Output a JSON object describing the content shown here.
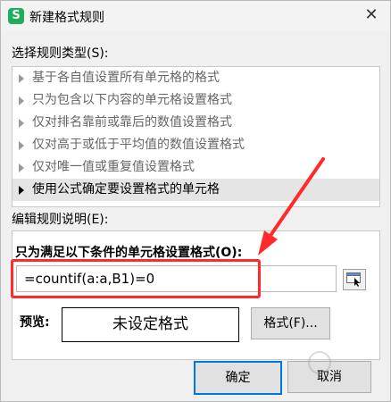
{
  "window": {
    "app_icon_letter": "S",
    "title": "新建格式规则",
    "close_glyph": "✕"
  },
  "rule_type": {
    "heading": "选择规则类型(S):",
    "items": [
      {
        "label": "基于各自值设置所有单元格的格式"
      },
      {
        "label": "只为包含以下内容的单元格设置格式"
      },
      {
        "label": "仅对排名靠前或靠后的数值设置格式"
      },
      {
        "label": "仅对高于或低于平均值的数值设置格式"
      },
      {
        "label": "仅对唯一值或重复值设置格式"
      },
      {
        "label": "使用公式确定要设置格式的单元格",
        "selected": true
      }
    ]
  },
  "description": {
    "heading": "编辑规则说明(E):",
    "formula_heading": "只为满足以下条件的单元格设置格式(O):",
    "formula_value": "=countif(a:a,B1)=0"
  },
  "preview": {
    "label": "预览:",
    "text": "未设定格式",
    "format_button": "格式(F)..."
  },
  "footer": {
    "ok_label": "确定",
    "cancel_label": "取消"
  },
  "colors": {
    "annotation": "#ff2b2b",
    "accent": "#0078d7",
    "app_icon": "#1fae5a"
  }
}
